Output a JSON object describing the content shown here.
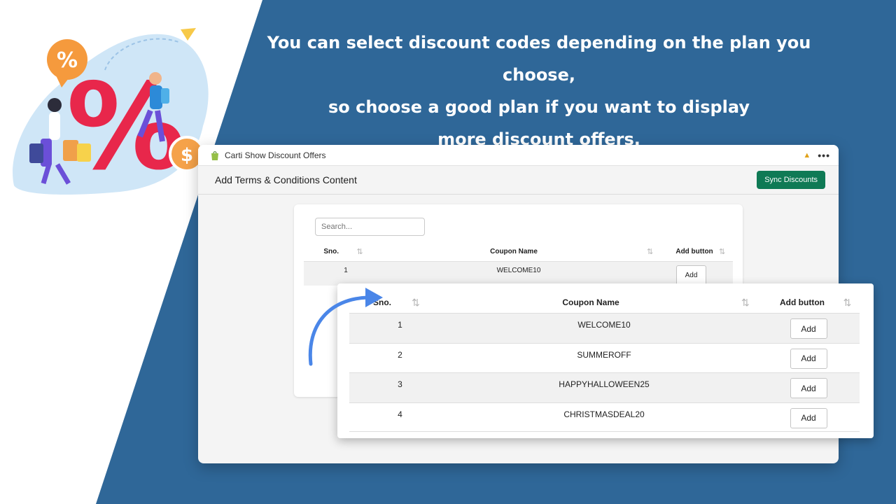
{
  "headline": {
    "line1": "You can select discount codes depending on the plan you choose,",
    "line2": "so choose a good plan if you want to display",
    "line3": "more discount offers."
  },
  "illustration": {
    "percent_badge": "%",
    "big_percent": "%",
    "dollar_coin": "$"
  },
  "window": {
    "title": "Carti Show Discount Offers",
    "menu": "•••"
  },
  "page": {
    "title": "Add Terms & Conditions Content",
    "sync_button": "Sync Discounts"
  },
  "search": {
    "placeholder": "Search..."
  },
  "table": {
    "columns": {
      "sno": "Sno.",
      "coupon": "Coupon Name",
      "add": "Add button"
    },
    "add_label": "Add",
    "rows": [
      {
        "sno": "1",
        "coupon": "WELCOME10"
      },
      {
        "sno": "2",
        "coupon": "SUMMEROFF"
      },
      {
        "sno": "3",
        "coupon": "HAPPYHALLOWEEN25"
      },
      {
        "sno": "4",
        "coupon": "CHRISTMASDEAL20"
      }
    ]
  },
  "colors": {
    "background_blue": "#2f6798",
    "sync_green": "#0f7a55",
    "arrow_blue": "#4a86e8",
    "percent_red": "#e8274b"
  }
}
